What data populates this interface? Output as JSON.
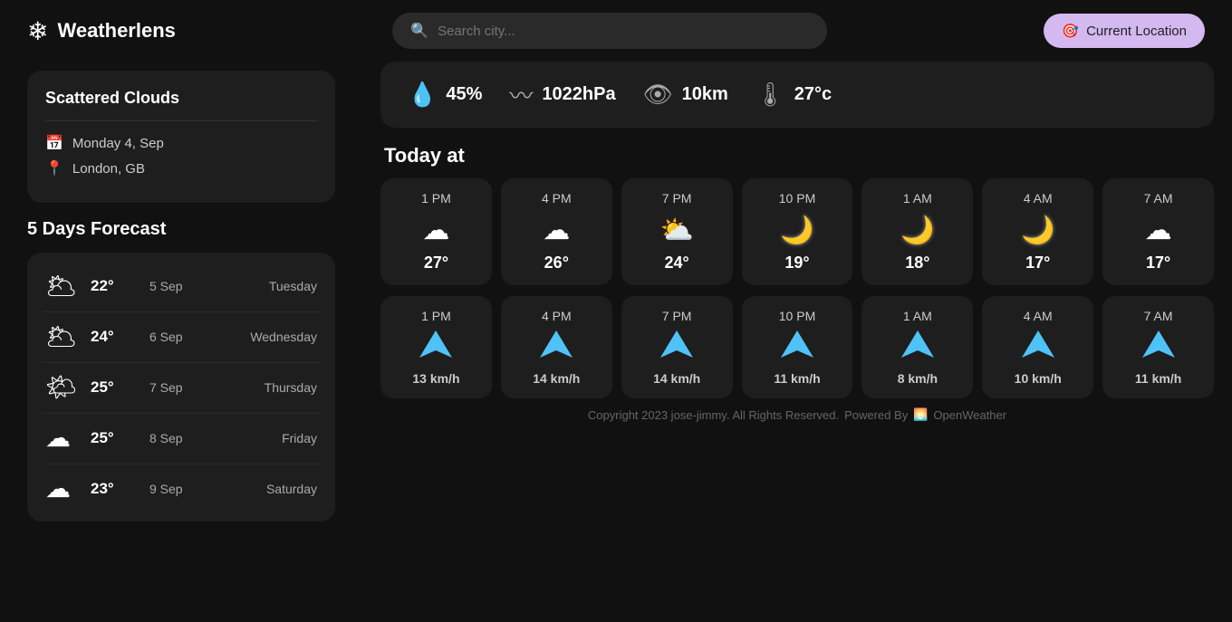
{
  "app": {
    "title": "Weatherlens",
    "logo_icon": "❄",
    "search_placeholder": "Search city...",
    "current_location_label": "Current Location"
  },
  "weather_card": {
    "condition": "Scattered Clouds",
    "date": "Monday 4, Sep",
    "location": "London, GB"
  },
  "stats": [
    {
      "icon": "💧",
      "value": "45%",
      "label": "humidity"
    },
    {
      "icon": "〰",
      "value": "1022hPa",
      "label": "pressure"
    },
    {
      "icon": "👁",
      "value": "10km",
      "label": "visibility"
    },
    {
      "icon": "🌡",
      "value": "27°c",
      "label": "feels_like"
    }
  ],
  "today_label": "Today at",
  "hourly_weather": [
    {
      "time": "1 PM",
      "icon": "☁",
      "temp": "27°"
    },
    {
      "time": "4 PM",
      "icon": "☁",
      "temp": "26°"
    },
    {
      "time": "7 PM",
      "icon": "🌤",
      "temp": "24°"
    },
    {
      "time": "10 PM",
      "icon": "🌙",
      "temp": "19°"
    },
    {
      "time": "1 AM",
      "icon": "🌙",
      "temp": "18°"
    },
    {
      "time": "4 AM",
      "icon": "🌙",
      "temp": "17°"
    },
    {
      "time": "7 AM",
      "icon": "☁",
      "temp": "17°"
    }
  ],
  "hourly_wind": [
    {
      "time": "1 PM",
      "speed": "13 km/h"
    },
    {
      "time": "4 PM",
      "speed": "14 km/h"
    },
    {
      "time": "7 PM",
      "speed": "14 km/h"
    },
    {
      "time": "10 PM",
      "speed": "11 km/h"
    },
    {
      "time": "1 AM",
      "speed": "8 km/h"
    },
    {
      "time": "4 AM",
      "speed": "10 km/h"
    },
    {
      "time": "7 AM",
      "speed": "11 km/h"
    }
  ],
  "forecast": {
    "title": "5 Days Forecast",
    "days": [
      {
        "icon": "🌥",
        "temp": "22°",
        "date": "5 Sep",
        "day": "Tuesday"
      },
      {
        "icon": "🌥",
        "temp": "24°",
        "date": "6 Sep",
        "day": "Wednesday"
      },
      {
        "icon": "🌤",
        "temp": "25°",
        "date": "7 Sep",
        "day": "Thursday"
      },
      {
        "icon": "☁",
        "temp": "25°",
        "date": "8 Sep",
        "day": "Friday"
      },
      {
        "icon": "☁",
        "temp": "23°",
        "date": "9 Sep",
        "day": "Saturday"
      }
    ]
  },
  "footer": {
    "copyright": "Copyright 2023 jose-jimmy. All Rights Reserved.",
    "powered_by": "Powered By",
    "provider": "OpenWeather"
  }
}
